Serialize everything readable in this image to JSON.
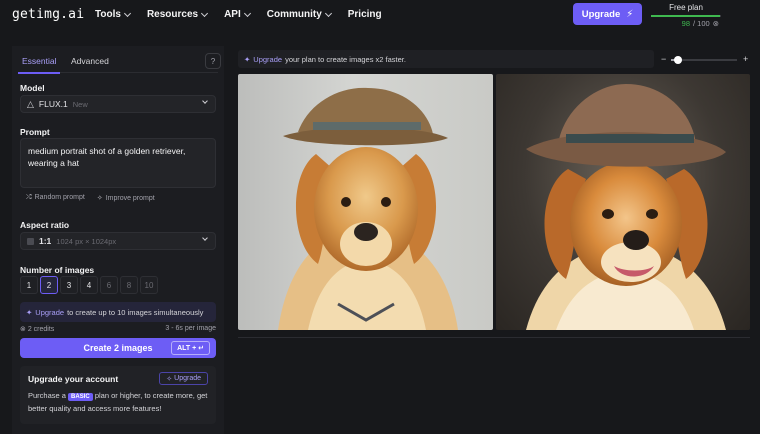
{
  "app": {
    "logo": "getimg.ai",
    "nav": [
      {
        "label": "Tools",
        "has_dropdown": true
      },
      {
        "label": "Resources",
        "has_dropdown": true
      },
      {
        "label": "API",
        "has_dropdown": true
      },
      {
        "label": "Community",
        "has_dropdown": true
      },
      {
        "label": "Pricing",
        "has_dropdown": false
      }
    ],
    "upgrade_label": "Upgrade",
    "plan": {
      "label": "Free plan",
      "used": "98",
      "total": "/ 100",
      "fraction_used": 0.98
    }
  },
  "panel": {
    "tabs": [
      "Essential",
      "Advanced"
    ],
    "active_tab": "Essential",
    "model": {
      "label": "Model",
      "name": "FLUX.1",
      "tag": "New"
    },
    "prompt": {
      "label": "Prompt",
      "value": "medium portrait shot of a golden retriever, wearing a hat",
      "random_label": "Random prompt",
      "improve_label": "Improve prompt"
    },
    "aspect": {
      "label": "Aspect ratio",
      "ratio": "1:1",
      "size": "1024 px × 1024px"
    },
    "images": {
      "label": "Number of images",
      "options": [
        "1",
        "2",
        "3",
        "4",
        "6",
        "8",
        "10"
      ],
      "selected": "2",
      "tip_link": "Upgrade",
      "tip_text": "to create up to 10 images simultaneously"
    },
    "credits": "2 credits",
    "timing": "3 - 6s per image",
    "create_label": "Create 2 images",
    "shortcut": "ALT + ↵",
    "upgrade_card": {
      "title": "Upgrade your account",
      "button": "Upgrade",
      "text_before": "Purchase a",
      "badge": "BASIC",
      "text_after": "plan or higher, to create more, get better quality and access more features!"
    }
  },
  "canvas": {
    "banner_link": "Upgrade",
    "banner_text": "your plan to create images x2 faster.",
    "zoom_minus": "−",
    "zoom_plus": "+",
    "zoom_level": 0.1,
    "colors": {
      "accent": "#6d5df5",
      "accent_text": "#a99ff7",
      "success": "#3fb950"
    }
  }
}
